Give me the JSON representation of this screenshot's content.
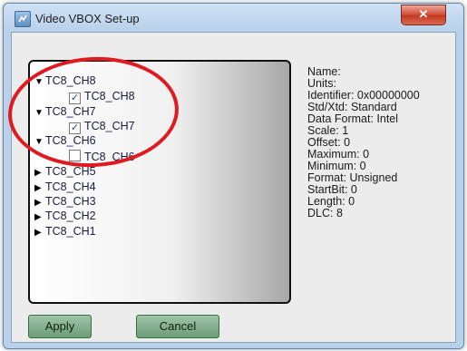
{
  "window": {
    "title": "Video VBOX Set-up",
    "close_glyph": "✕"
  },
  "tree": [
    {
      "label": "TC8_CH8",
      "expanded": true,
      "child": {
        "label": "TC8_CH8",
        "checked": true
      }
    },
    {
      "label": "TC8_CH7",
      "expanded": true,
      "child": {
        "label": "TC8_CH7",
        "checked": true
      }
    },
    {
      "label": "TC8_CH6",
      "expanded": true,
      "child": {
        "label": "TC8_CH6",
        "checked": false
      }
    },
    {
      "label": "TC8_CH5",
      "expanded": false
    },
    {
      "label": "TC8_CH4",
      "expanded": false
    },
    {
      "label": "TC8_CH3",
      "expanded": false
    },
    {
      "label": "TC8_CH2",
      "expanded": false
    },
    {
      "label": "TC8_CH1",
      "expanded": false
    }
  ],
  "glyphs": {
    "expanded": "▼",
    "collapsed": "▶",
    "check": "✓"
  },
  "details": [
    "Name:",
    "Units:",
    "Identifier: 0x00000000",
    "Std/Xtd: Standard",
    "Data Format: Intel",
    "Scale: 1",
    "Offset: 0",
    "Maximum: 0",
    "Minimum: 0",
    "Format: Unsigned",
    "StartBit: 0",
    "Length: 0",
    "DLC: 8"
  ],
  "buttons": {
    "apply": "Apply",
    "cancel": "Cancel"
  },
  "colors": {
    "annotation": "#e01a21",
    "button": "#7fae8b"
  }
}
